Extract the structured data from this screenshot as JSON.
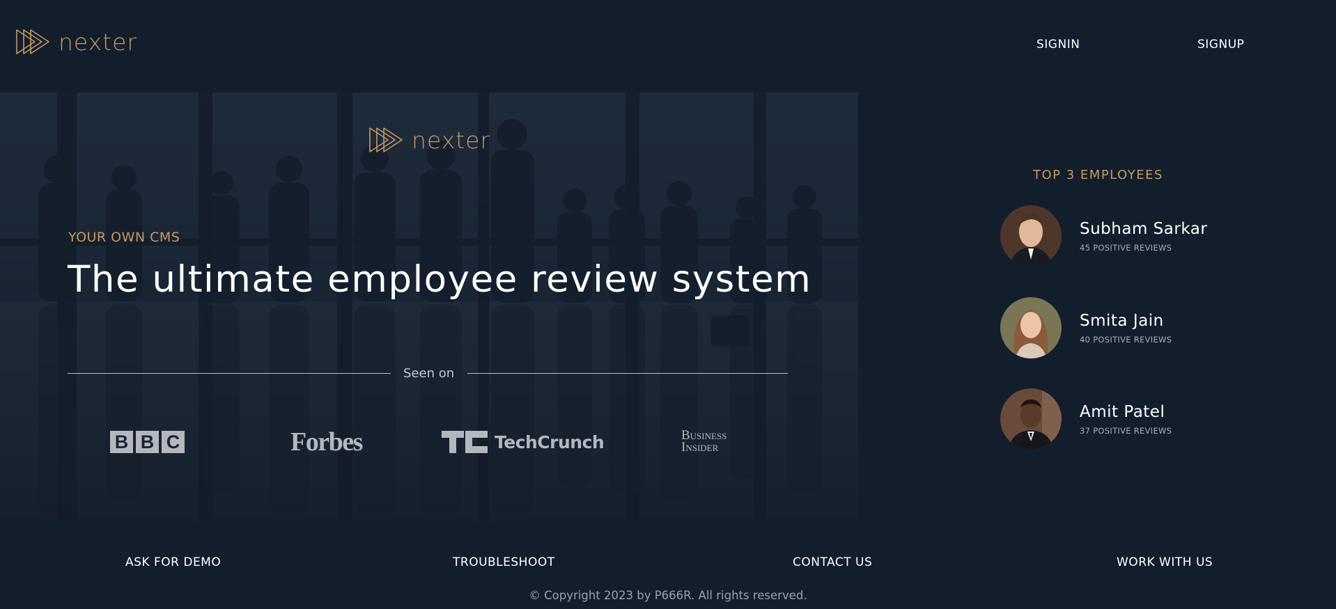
{
  "brand": {
    "name": "nexter",
    "accent": "#c69963",
    "background": "#131e2c"
  },
  "nav": {
    "signin_label": "SIGNIN",
    "signup_label": "SIGNUP"
  },
  "hero": {
    "kicker": "YOUR OWN CMS",
    "title": "The ultimate employee review system",
    "seen_on_label": "Seen on",
    "press": [
      {
        "name": "BBC",
        "letters": [
          "B",
          "B",
          "C"
        ]
      },
      {
        "name": "Forbes"
      },
      {
        "name": "TechCrunch"
      },
      {
        "name": "Business Insider",
        "line1": "Business",
        "line2": "Insider"
      }
    ]
  },
  "sidebar": {
    "title": "TOP 3 EMPLOYEES",
    "employees": [
      {
        "name": "Subham Sarkar",
        "reviews": "45 POSITIVE REVIEWS"
      },
      {
        "name": "Smita Jain",
        "reviews": "40 POSITIVE REVIEWS"
      },
      {
        "name": "Amit Patel",
        "reviews": "37 POSITIVE REVIEWS"
      }
    ]
  },
  "footer": {
    "links": [
      "ASK FOR DEMO",
      "TROUBLESHOOT",
      "CONTACT US",
      "WORK WITH US"
    ],
    "copyright": "© Copyright 2023 by P666R. All rights reserved."
  }
}
